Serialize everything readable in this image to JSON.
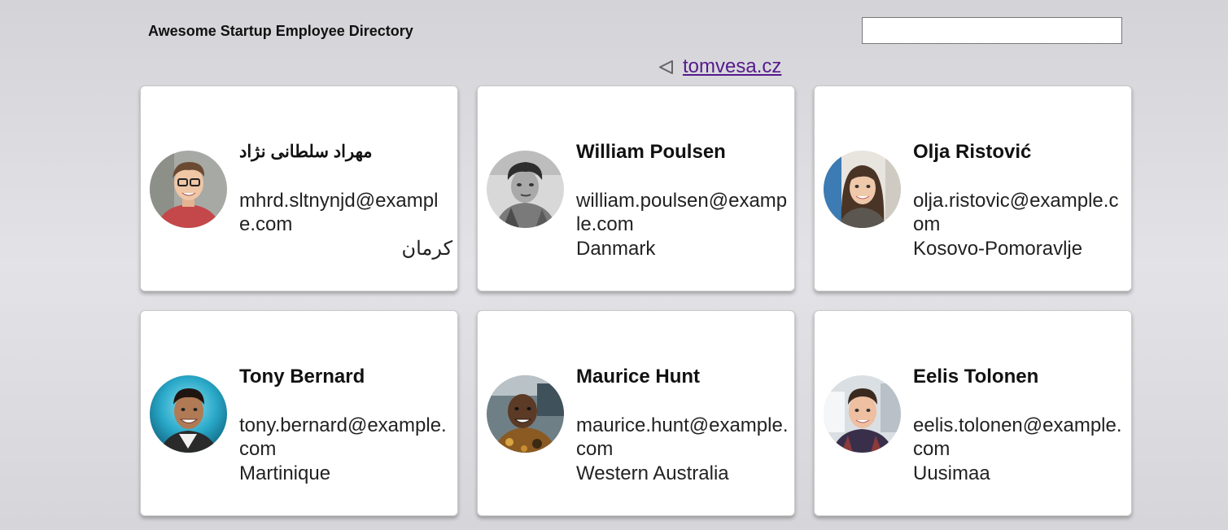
{
  "header": {
    "title": "Awesome Startup Employee Directory",
    "search_value": "",
    "search_placeholder": ""
  },
  "credit": {
    "icon": "play-back-icon",
    "link_text": "tomvesa.cz"
  },
  "colors": {
    "link": "#551a8b",
    "card_bg": "#ffffff",
    "page_bg": "#dcdce0"
  },
  "employees": [
    {
      "name": "مهراد سلطانی نژاد",
      "email": "mhrd.sltnynjd@example.com",
      "location": "کرمان"
    },
    {
      "name": "William Poulsen",
      "email": "william.poulsen@example.com",
      "location": "Danmark"
    },
    {
      "name": "Olja Ristović",
      "email": "olja.ristovic@example.com",
      "location": "Kosovo-Pomoravlje"
    },
    {
      "name": "Tony Bernard",
      "email": "tony.bernard@example.com",
      "location": "Martinique"
    },
    {
      "name": "Maurice Hunt",
      "email": "maurice.hunt@example.com",
      "location": "Western Australia"
    },
    {
      "name": "Eelis Tolonen",
      "email": "eelis.tolonen@example.com",
      "location": "Uusimaa"
    }
  ]
}
